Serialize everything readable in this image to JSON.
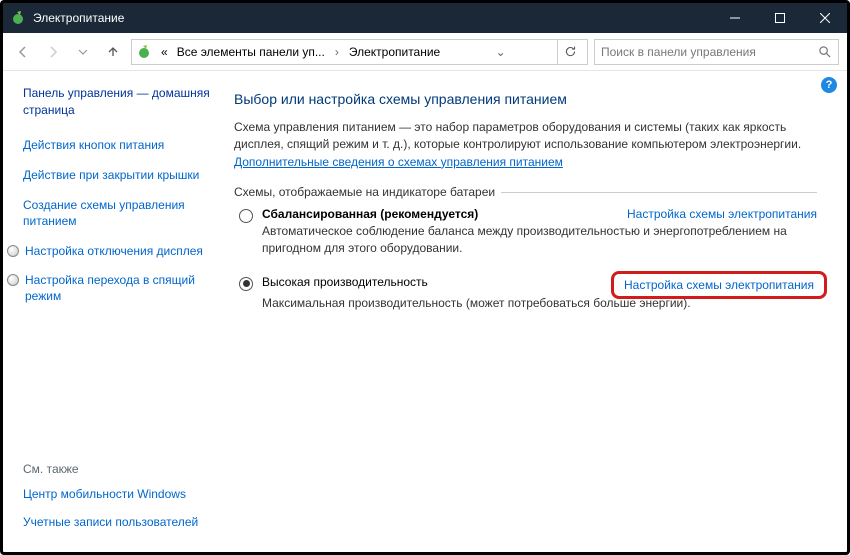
{
  "titlebar": {
    "title": "Электропитание"
  },
  "breadcrumb": {
    "prefix": "«",
    "item1": "Все элементы панели уп...",
    "item2": "Электропитание"
  },
  "search": {
    "placeholder": "Поиск в панели управления"
  },
  "sidebar": {
    "home": "Панель управления — домашняя страница",
    "l1": "Действия кнопок питания",
    "l2": "Действие при закрытии крышки",
    "l3": "Создание схемы управления питанием",
    "l4": "Настройка отключения дисплея",
    "l5": "Настройка перехода в спящий режим",
    "see_also": "См. также",
    "s1": "Центр мобильности Windows",
    "s2": "Учетные записи пользователей"
  },
  "main": {
    "heading": "Выбор или настройка схемы управления питанием",
    "desc": "Схема управления питанием — это набор параметров оборудования и системы (таких как яркость дисплея, спящий режим и т. д.), которые контролируют использование компьютером электроэнергии.",
    "more_link": "Дополнительные сведения о схемах управления питанием",
    "group_label": "Схемы, отображаемые на индикаторе батареи",
    "plans": {
      "p1": {
        "name": "Сбалансированная (рекомендуется)",
        "desc": "Автоматическое соблюдение баланса между производительностью и энергопотреблением на пригодном для этого оборудовании.",
        "link": "Настройка схемы электропитания"
      },
      "p2": {
        "name": "Высокая производительность",
        "desc": "Максимальная производительность (может потребоваться больше энергии).",
        "link": "Настройка схемы электропитания"
      }
    }
  }
}
